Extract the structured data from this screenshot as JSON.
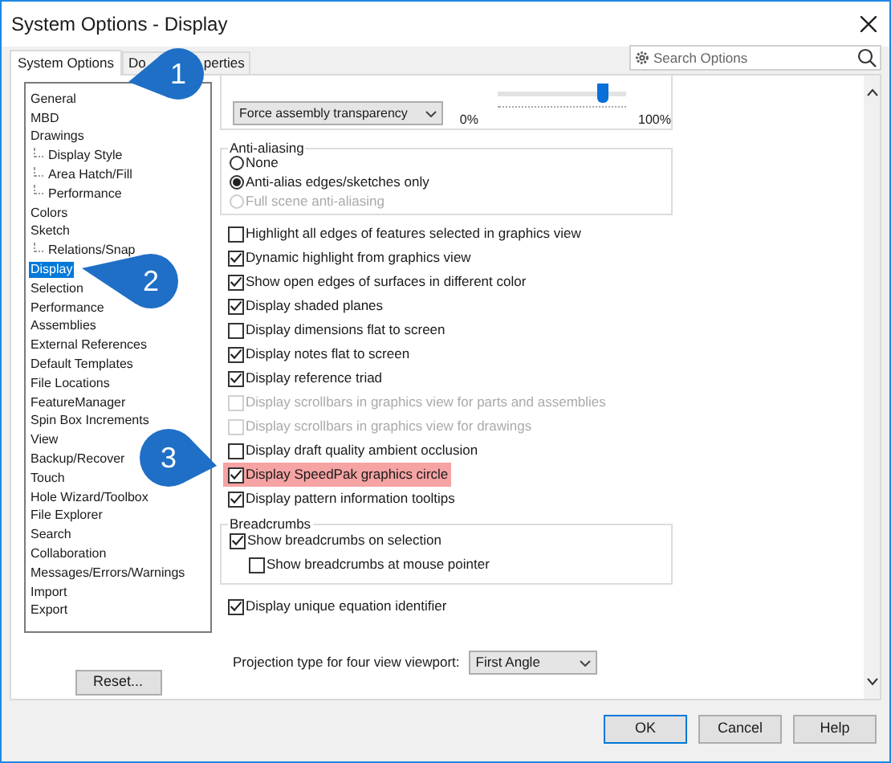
{
  "window": {
    "title": "System Options - Display"
  },
  "tabs": [
    {
      "label": "System Options",
      "selected": true
    },
    {
      "label_start": "Do",
      "label_end": "perties",
      "selected": false
    }
  ],
  "search": {
    "placeholder": "Search Options"
  },
  "tree": [
    {
      "label": "General",
      "selected": false
    },
    {
      "label": "MBD",
      "selected": false
    },
    {
      "label": "Drawings",
      "selected": false,
      "children": [
        {
          "label": "Display Style",
          "selected": false
        },
        {
          "label": "Area Hatch/Fill",
          "selected": false
        },
        {
          "label": "Performance",
          "selected": false
        }
      ]
    },
    {
      "label": "Colors",
      "selected": false
    },
    {
      "label": "Sketch",
      "selected": false,
      "children": [
        {
          "label": "Relations/Snap",
          "selected": false
        }
      ]
    },
    {
      "label": "Display",
      "selected": true
    },
    {
      "label": "Selection",
      "selected": false
    },
    {
      "label": "Performance",
      "selected": false
    },
    {
      "label": "Assemblies",
      "selected": false
    },
    {
      "label": "External References",
      "selected": false
    },
    {
      "label": "Default Templates",
      "selected": false
    },
    {
      "label": "File Locations",
      "selected": false
    },
    {
      "label": "FeatureManager",
      "selected": false
    },
    {
      "label": "Spin Box Increments",
      "selected": false
    },
    {
      "label": "View",
      "selected": false
    },
    {
      "label": "Backup/Recover",
      "selected": false
    },
    {
      "label": "Touch",
      "selected": false
    },
    {
      "label": "Hole Wizard/Toolbox",
      "selected": false
    },
    {
      "label": "File Explorer",
      "selected": false
    },
    {
      "label": "Search",
      "selected": false
    },
    {
      "label": "Collaboration",
      "selected": false
    },
    {
      "label": "Messages/Errors/Warnings",
      "selected": false
    },
    {
      "label": "Import",
      "selected": false
    },
    {
      "label": "Export",
      "selected": false
    }
  ],
  "reset_button": "Reset...",
  "transparency": {
    "dropdown": "Force assembly transparency",
    "min_label": "0%",
    "max_label": "100%",
    "level": 0.85
  },
  "anti_aliasing": {
    "title": "Anti-aliasing",
    "options": [
      {
        "label": "None",
        "selected": false,
        "disabled": false
      },
      {
        "label": "Anti-alias edges/sketches only",
        "selected": true,
        "disabled": false
      },
      {
        "label": "Full scene anti-aliasing",
        "selected": false,
        "disabled": true
      }
    ]
  },
  "checkboxes": [
    {
      "label": "Highlight all edges of features selected in graphics view",
      "checked": false,
      "disabled": false,
      "highlighted": false
    },
    {
      "label": "Dynamic highlight from graphics view",
      "checked": true,
      "disabled": false,
      "highlighted": false
    },
    {
      "label": "Show open edges of surfaces in different color",
      "checked": true,
      "disabled": false,
      "highlighted": false
    },
    {
      "label": "Display shaded planes",
      "checked": true,
      "disabled": false,
      "highlighted": false
    },
    {
      "label": "Display dimensions flat to screen",
      "checked": false,
      "disabled": false,
      "highlighted": false
    },
    {
      "label": "Display notes flat to screen",
      "checked": true,
      "disabled": false,
      "highlighted": false
    },
    {
      "label": "Display reference triad",
      "checked": true,
      "disabled": false,
      "highlighted": false
    },
    {
      "label": "Display scrollbars in graphics view for parts and assemblies",
      "checked": false,
      "disabled": true,
      "highlighted": false
    },
    {
      "label": "Display scrollbars in graphics view for drawings",
      "checked": false,
      "disabled": true,
      "highlighted": false
    },
    {
      "label": "Display draft quality ambient occlusion",
      "checked": false,
      "disabled": false,
      "highlighted": false
    },
    {
      "label": "Display SpeedPak graphics circle",
      "checked": true,
      "disabled": false,
      "highlighted": true
    },
    {
      "label": "Display pattern information tooltips",
      "checked": true,
      "disabled": false,
      "highlighted": false
    }
  ],
  "breadcrumbs": {
    "title": "Breadcrumbs",
    "options": [
      {
        "label": "Show breadcrumbs on selection",
        "checked": true
      },
      {
        "label": "Show breadcrumbs at mouse pointer",
        "checked": false
      }
    ]
  },
  "equation_identifier": {
    "label": "Display unique equation identifier",
    "checked": true
  },
  "projection": {
    "label": "Projection type for four view viewport:",
    "value": "First Angle"
  },
  "buttons": [
    {
      "label": "OK",
      "default": true
    },
    {
      "label": "Cancel",
      "default": false
    },
    {
      "label": "Help",
      "default": false
    }
  ],
  "callouts": [
    {
      "number": "1"
    },
    {
      "number": "2"
    },
    {
      "number": "3"
    }
  ]
}
